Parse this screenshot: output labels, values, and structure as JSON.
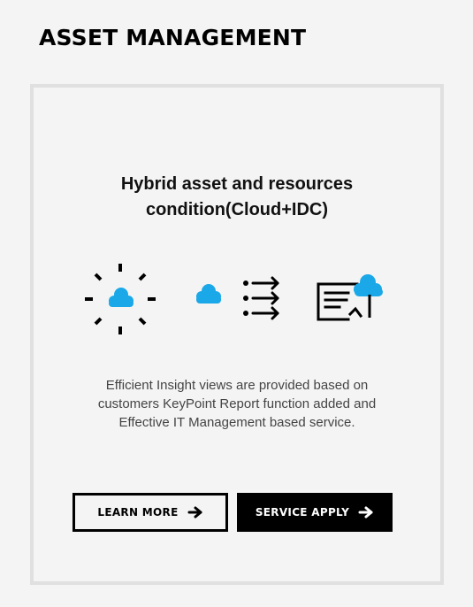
{
  "header": {
    "title": "ASSET MANAGEMENT"
  },
  "card": {
    "heading_line1": "Hybrid asset and resources",
    "heading_line2": "condition(Cloud+IDC)",
    "description_line1": "Efficient Insight views are provided based on",
    "description_line2": "customers KeyPoint Report function added and",
    "description_line3": "Effective IT Management based service.",
    "icons": [
      "cloud-burst-icon",
      "cloud-list-icon",
      "cloud-report-icon"
    ],
    "buttons": {
      "learn_more_label": "LEARN MORE",
      "service_apply_label": "SERVICE APPLY"
    }
  },
  "colors": {
    "accent": "#1aa8e8",
    "text": "#000000",
    "background": "#f4f4f4",
    "border": "#e0e0e0"
  }
}
